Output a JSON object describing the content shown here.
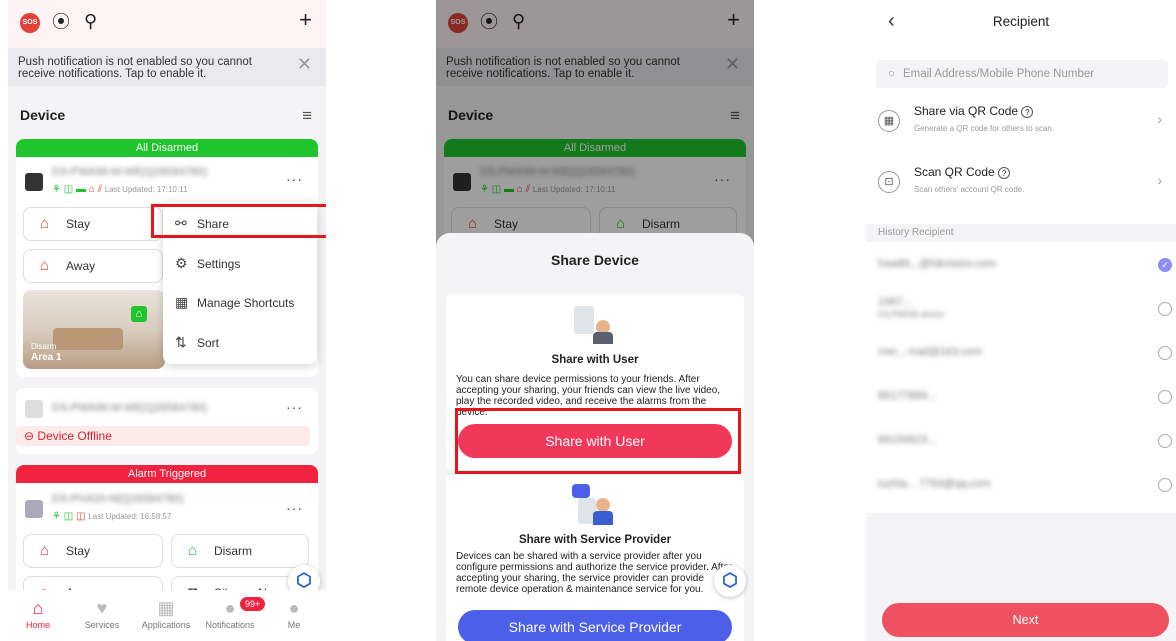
{
  "colors": {
    "accent": "#f1223e",
    "green": "#1ec52c",
    "blue": "#4b5fe8",
    "highlight": "#e8151b"
  },
  "home": {
    "sos": "SOS",
    "push_notice": "Push notification is not enabled so you cannot receive notifications. Tap to enable it.",
    "device_title": "Device",
    "group1": {
      "banner": "All Disarmed",
      "updated": "Last Updated: 17:10:11",
      "stay": "Stay",
      "away": "Away",
      "area_state": "Disarm",
      "area_name": "Area 1"
    },
    "menu": {
      "share": "Share",
      "settings": "Settings",
      "shortcuts": "Manage Shortcuts",
      "sort": "Sort"
    },
    "offline": "Device Offline",
    "group2": {
      "banner": "Alarm Triggered",
      "updated": "Last Updated: 16:58:57",
      "stay": "Stay",
      "disarm": "Disarm",
      "away": "Away",
      "silence": "Silence Alarm"
    },
    "tabs": [
      "Home",
      "Services",
      "Applications",
      "Notifications",
      "Me"
    ],
    "badge": "99+"
  },
  "share": {
    "title": "Share Device",
    "user": {
      "title": "Share with User",
      "desc": "You can share device permissions to your friends. After accepting your sharing, your friends can view the live video, play the recorded video, and receive the alarms from the device.",
      "button": "Share with User"
    },
    "provider": {
      "title": "Share with Service Provider",
      "desc": "Devices can be shared with a service provider after you configure permissions and authorize the service provider. After accepting your sharing, the service provider can provide remote device operation & maintenance service for you.",
      "button": "Share with Service Provider"
    }
  },
  "recipient": {
    "title": "Recipient",
    "search_placeholder": "Email Address/Mobile Phone Number",
    "qr_share": {
      "title": "Share via QR Code",
      "sub": "Generate a QR code for others to scan."
    },
    "qr_scan": {
      "title": "Scan QR Code",
      "sub": "Scan others' account QR code."
    },
    "history_label": "History Recipient",
    "next": "Next"
  }
}
